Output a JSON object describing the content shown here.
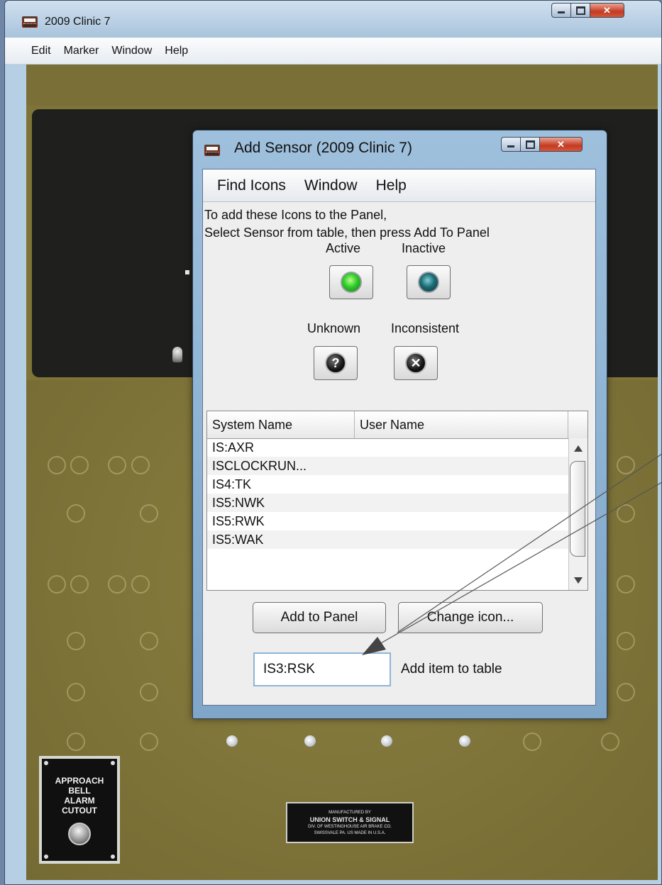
{
  "outer_window": {
    "title": "2009 Clinic 7",
    "menu": [
      "Edit",
      "Marker",
      "Window",
      "Help"
    ]
  },
  "dialog": {
    "title": "Add Sensor (2009 Clinic 7)",
    "menu": [
      "Find Icons",
      "Window",
      "Help"
    ],
    "instructions": [
      "To add these Icons to the Panel,",
      "Select Sensor from table, then press Add To Panel"
    ],
    "states": {
      "active": "Active",
      "inactive": "Inactive",
      "unknown": "Unknown",
      "inconsistent": "Inconsistent"
    },
    "table": {
      "columns": [
        "System Name",
        "User Name"
      ],
      "rows": [
        {
          "system": "IS:AXR",
          "user": ""
        },
        {
          "system": "ISCLOCKRUN...",
          "user": ""
        },
        {
          "system": "IS4:TK",
          "user": ""
        },
        {
          "system": "IS5:NWK",
          "user": ""
        },
        {
          "system": "IS5:RWK",
          "user": ""
        },
        {
          "system": "IS5:WAK",
          "user": ""
        }
      ]
    },
    "buttons": {
      "add_to_panel": "Add to Panel",
      "change_icon": "Change icon..."
    },
    "input": {
      "value": "IS3:RSK",
      "label": "Add item to table"
    }
  },
  "panel": {
    "bell_plate": [
      "APPROACH",
      "BELL",
      "ALARM",
      "CUTOUT"
    ],
    "maker_plate": {
      "line1": "MANUFACTURED BY",
      "line2": "UNION SWITCH & SIGNAL",
      "line3": "DIV. OF WESTINGHOUSE AIR BRAKE CO.",
      "line4": "SWISSVALE PA.  US  MADE IN U.S.A."
    }
  },
  "colors": {
    "panel_olive": "#7f7438",
    "panel_black": "#1f1f1d",
    "vista_frame": "#9ec0dd",
    "close_red": "#c43a22",
    "led_active": "#2fcc2a",
    "led_inactive": "#1b6a74"
  },
  "icons": [
    "app-train-icon",
    "minimize-icon",
    "maximize-icon",
    "close-icon",
    "question-icon",
    "x-icon",
    "scroll-up-icon",
    "scroll-down-icon"
  ]
}
